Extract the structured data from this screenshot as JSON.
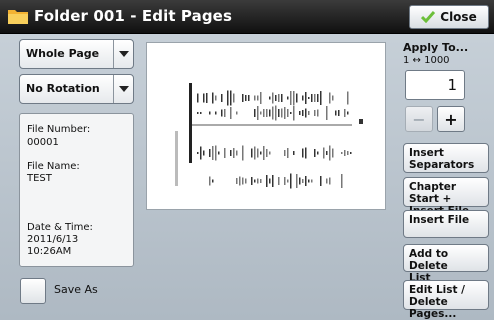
{
  "header": {
    "title": "Folder 001 - Edit Pages",
    "close_label": "Close"
  },
  "left": {
    "page_select": "Whole Page",
    "rotation_select": "No Rotation",
    "file_number_label": "File Number:",
    "file_number": "00001",
    "file_name_label": "File Name:",
    "file_name": "TEST",
    "datetime_label": "Date & Time:",
    "date": "2011/6/13",
    "time": "10:26AM",
    "save_as_label": "Save As",
    "save_as_checked": false
  },
  "right": {
    "apply_title": "Apply To...",
    "apply_range": "1 ↔ 1000",
    "page_value": "1",
    "minus_label": "−",
    "plus_label": "+",
    "buttons": {
      "insert_separators": [
        "Insert",
        "Separators"
      ],
      "chapter_start": [
        "Chapter Start +",
        "Insert File"
      ],
      "insert_file": [
        "Insert File"
      ],
      "add_to_delete": [
        "Add to Delete",
        "List"
      ],
      "edit_list": [
        "Edit List /",
        "Delete Pages..."
      ]
    }
  },
  "colors": {
    "title_bar": "#1c1c1c",
    "folder_icon": "#f2b233",
    "check_icon": "#6cbf3a",
    "panel_bg": "#b9c3cc"
  },
  "icons": {
    "folder": "folder-icon",
    "close_check": "check-icon",
    "dropdown": "chevron-down-icon"
  }
}
